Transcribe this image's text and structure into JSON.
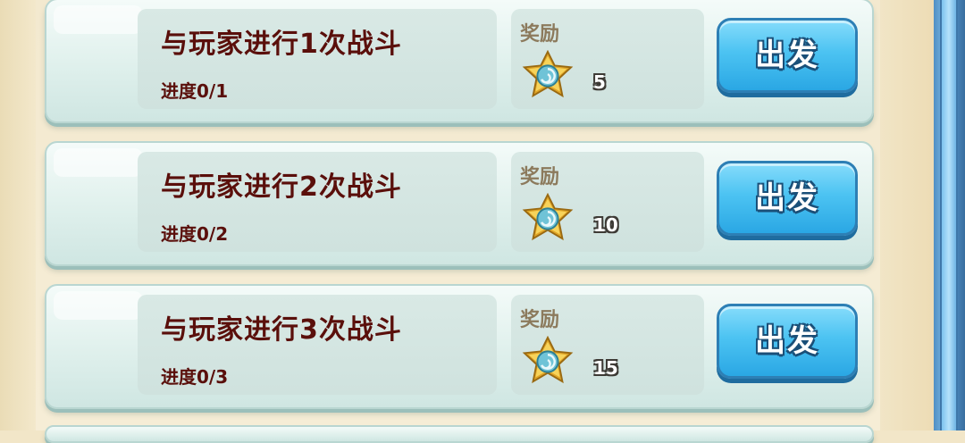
{
  "quests": [
    {
      "title": "与玩家进行1次战斗",
      "progress_label": "进度",
      "progress_value": "0/1",
      "reward_label": "奖励",
      "reward_icon": "star-coin-icon",
      "reward_amount": "5",
      "button_label": "出发"
    },
    {
      "title": "与玩家进行2次战斗",
      "progress_label": "进度",
      "progress_value": "0/2",
      "reward_label": "奖励",
      "reward_icon": "star-coin-icon",
      "reward_amount": "10",
      "button_label": "出发"
    },
    {
      "title": "与玩家进行3次战斗",
      "progress_label": "进度",
      "progress_value": "0/3",
      "reward_label": "奖励",
      "reward_icon": "star-coin-icon",
      "reward_amount": "15",
      "button_label": "出发"
    }
  ],
  "colors": {
    "title_text": "#5a0f0b",
    "button_blue": "#4cc3f2",
    "card_bg": "#dff0ec",
    "star_gold": "#f3c23a"
  }
}
